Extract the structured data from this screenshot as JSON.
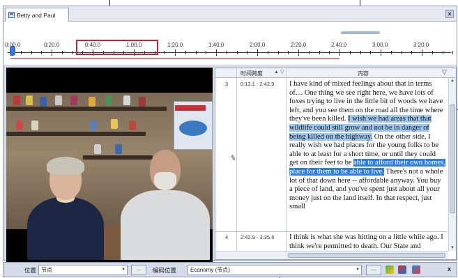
{
  "tab": {
    "title": "Betty and Paul"
  },
  "timeline": {
    "labels": [
      "0:00.0",
      "0:20.0",
      "0:40.0",
      "1:00.0",
      "1:20.0",
      "1:40.0",
      "2:00.0",
      "2:20.0",
      "2:40.0",
      "3:00.0",
      "3:20.0"
    ]
  },
  "grid": {
    "headers": {
      "time": "时间跨度",
      "sort": "▲ ▽",
      "content": "内容",
      "filter": "▽"
    },
    "rows": [
      {
        "num": "3",
        "time": "0:13.1 - 2:42.9",
        "seg1": "I have kind of mixed feelings about that in terms of.... One thing we see right here, we have lots of foxes trying to live in the little bit of woods we have left, and you see them on the road all the time where they've been killed. ",
        "seg2": "I wish we had areas that that wildlife could still grow and not be in danger of being killed on the highway.",
        "seg3": " On the other side, I really wish we had places for the young folks to be able to at least for a short time, or until they could get on their feet to be ",
        "seg4": "able to afford their own homes, place for them to be able to live.",
        "seg5": " There's not a whole lot of that down here -- affordable anyway. You buy a piece of land, and you've spent just about all your money just on the land itself. In that respect, just small"
      },
      {
        "num": "4",
        "time": "2:42.9 - 3:35.6",
        "text": "I think is what she was hitting on a little while ago. I think we're permitted to death. Our State and"
      }
    ]
  },
  "bottombar": {
    "position_label": "位置",
    "position_value": "节点",
    "encode_label": "编码位置",
    "encode_value": "Economy (节点)",
    "more": "...",
    "close": "x"
  },
  "colors": {
    "highlight": "#9fc6ec",
    "highlight_strong": "#2f7fe0",
    "accent_red": "#d11f2c"
  }
}
